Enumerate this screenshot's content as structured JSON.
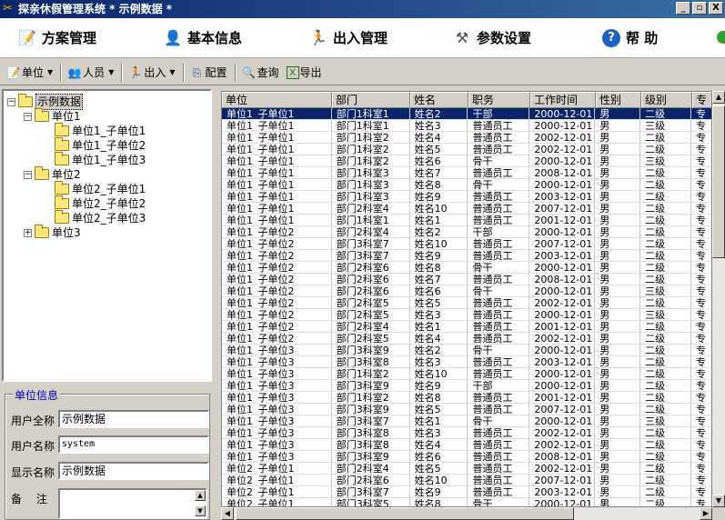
{
  "window": {
    "title": "探亲休假管理系统 * 示例数据 *",
    "btn_min": "_",
    "btn_max": "▫",
    "btn_close": "X"
  },
  "mainbar": {
    "items": [
      {
        "label": "方案管理",
        "icon": "scheme-icon"
      },
      {
        "label": "基本信息",
        "icon": "person-icon"
      },
      {
        "label": "出入管理",
        "icon": "runner-icon"
      },
      {
        "label": "参数设置",
        "icon": "tools-icon"
      },
      {
        "label": "帮 助",
        "icon": "help-icon"
      }
    ]
  },
  "toolbar": {
    "unit": "单位",
    "staff": "人员",
    "inout": "出入",
    "config": "配置",
    "query": "查询",
    "export": "导出"
  },
  "tree": {
    "root": "示例数据",
    "unit1": "单位1",
    "unit1_children": [
      "单位1_子单位1",
      "单位1_子单位2",
      "单位1_子单位3"
    ],
    "unit2": "单位2",
    "unit2_children": [
      "单位2_子单位1",
      "单位2_子单位2",
      "单位2_子单位3"
    ],
    "unit3": "单位3"
  },
  "info": {
    "title": "单位信息",
    "full_name_label": "用户全称",
    "full_name": "示例数据",
    "user_name_label": "用户名称",
    "user_name": "system",
    "display_name_label": "显示名称",
    "display_name": "示例数据",
    "note_label": "备　 注",
    "note": ""
  },
  "grid": {
    "columns": [
      "单位",
      "部门",
      "姓名",
      "职务",
      "工作时间",
      "性别",
      "级别",
      "专"
    ],
    "rows": [
      [
        "单位1_子单位1",
        "部门1科室1",
        "姓名2",
        "干部",
        "2000-12-01",
        "男",
        "二级",
        "专"
      ],
      [
        "单位1_子单位1",
        "部门1科室1",
        "姓名3",
        "普通员工",
        "2000-12-01",
        "男",
        "三级",
        "专"
      ],
      [
        "单位1_子单位1",
        "部门1科室2",
        "姓名4",
        "普通员工",
        "2002-12-01",
        "男",
        "二级",
        "专"
      ],
      [
        "单位1_子单位1",
        "部门1科室2",
        "姓名5",
        "普通员工",
        "2002-12-01",
        "男",
        "二级",
        "专"
      ],
      [
        "单位1_子单位1",
        "部门1科室2",
        "姓名6",
        "骨干",
        "2000-12-01",
        "男",
        "三级",
        "专"
      ],
      [
        "单位1_子单位1",
        "部门1科室3",
        "姓名7",
        "普通员工",
        "2008-12-01",
        "男",
        "二级",
        "专"
      ],
      [
        "单位1_子单位1",
        "部门1科室3",
        "姓名8",
        "骨干",
        "2000-12-01",
        "男",
        "二级",
        "专"
      ],
      [
        "单位1_子单位1",
        "部门1科室3",
        "姓名9",
        "普通员工",
        "2003-12-01",
        "男",
        "二级",
        "专"
      ],
      [
        "单位1_子单位1",
        "部门2科室4",
        "姓名10",
        "普通员工",
        "2007-12-01",
        "男",
        "二级",
        "专"
      ],
      [
        "单位1_子单位1",
        "部门1科室1",
        "姓名1",
        "普通员工",
        "2001-12-01",
        "男",
        "二级",
        "专"
      ],
      [
        "单位1_子单位2",
        "部门2科室4",
        "姓名2",
        "干部",
        "2000-12-01",
        "男",
        "二级",
        "专"
      ],
      [
        "单位1_子单位2",
        "部门3科室7",
        "姓名10",
        "普通员工",
        "2007-12-01",
        "男",
        "二级",
        "专"
      ],
      [
        "单位1_子单位2",
        "部门3科室7",
        "姓名9",
        "普通员工",
        "2003-12-01",
        "男",
        "二级",
        "专"
      ],
      [
        "单位1_子单位2",
        "部门2科室6",
        "姓名8",
        "骨干",
        "2000-12-01",
        "男",
        "二级",
        "专"
      ],
      [
        "单位1_子单位2",
        "部门2科室6",
        "姓名7",
        "普通员工",
        "2008-12-01",
        "男",
        "二级",
        "专"
      ],
      [
        "单位1_子单位2",
        "部门2科室6",
        "姓名6",
        "骨干",
        "2000-12-01",
        "男",
        "三级",
        "专"
      ],
      [
        "单位1_子单位2",
        "部门2科室5",
        "姓名5",
        "普通员工",
        "2002-12-01",
        "男",
        "二级",
        "专"
      ],
      [
        "单位1_子单位2",
        "部门2科室5",
        "姓名3",
        "普通员工",
        "2000-12-01",
        "男",
        "三级",
        "专"
      ],
      [
        "单位1_子单位2",
        "部门2科室4",
        "姓名1",
        "普通员工",
        "2001-12-01",
        "男",
        "二级",
        "专"
      ],
      [
        "单位1_子单位2",
        "部门2科室5",
        "姓名4",
        "普通员工",
        "2002-12-01",
        "男",
        "二级",
        "专"
      ],
      [
        "单位1_子单位3",
        "部门3科室9",
        "姓名2",
        "骨干",
        "2000-12-01",
        "男",
        "二级",
        "专"
      ],
      [
        "单位1_子单位3",
        "部门3科室8",
        "姓名3",
        "普通员工",
        "2003-12-01",
        "男",
        "二级",
        "专"
      ],
      [
        "单位1_子单位3",
        "部门1科室2",
        "姓名10",
        "普通员工",
        "2000-12-01",
        "男",
        "二级",
        "专"
      ],
      [
        "单位1_子单位3",
        "部门3科室9",
        "姓名9",
        "干部",
        "2000-12-01",
        "男",
        "二级",
        "专"
      ],
      [
        "单位1_子单位3",
        "部门1科室2",
        "姓名8",
        "普通员工",
        "2001-12-01",
        "男",
        "二级",
        "专"
      ],
      [
        "单位1_子单位3",
        "部门3科室9",
        "姓名5",
        "普通员工",
        "2007-12-01",
        "男",
        "二级",
        "专"
      ],
      [
        "单位1_子单位3",
        "部门3科室7",
        "姓名1",
        "骨干",
        "2000-12-01",
        "男",
        "三级",
        "专"
      ],
      [
        "单位1_子单位3",
        "部门3科室8",
        "姓名3",
        "普通员工",
        "2002-12-01",
        "男",
        "二级",
        "专"
      ],
      [
        "单位1_子单位3",
        "部门3科室8",
        "姓名4",
        "普通员工",
        "2002-12-01",
        "男",
        "二级",
        "专"
      ],
      [
        "单位1_子单位3",
        "部门3科室9",
        "姓名6",
        "普通员工",
        "2008-12-01",
        "男",
        "二级",
        "专"
      ],
      [
        "单位2_子单位1",
        "部门2科室4",
        "姓名5",
        "普通员工",
        "2002-12-01",
        "男",
        "二级",
        "专"
      ],
      [
        "单位2_子单位1",
        "部门2科室6",
        "姓名10",
        "普通员工",
        "2007-12-01",
        "男",
        "二级",
        "专"
      ],
      [
        "单位2_子单位1",
        "部门3科室7",
        "姓名9",
        "普通员工",
        "2003-12-01",
        "男",
        "二级",
        "专"
      ],
      [
        "单位2_子单位1",
        "部门3科室5",
        "姓名8",
        "骨干",
        "2000-12-01",
        "男",
        "二级",
        "专"
      ]
    ]
  }
}
